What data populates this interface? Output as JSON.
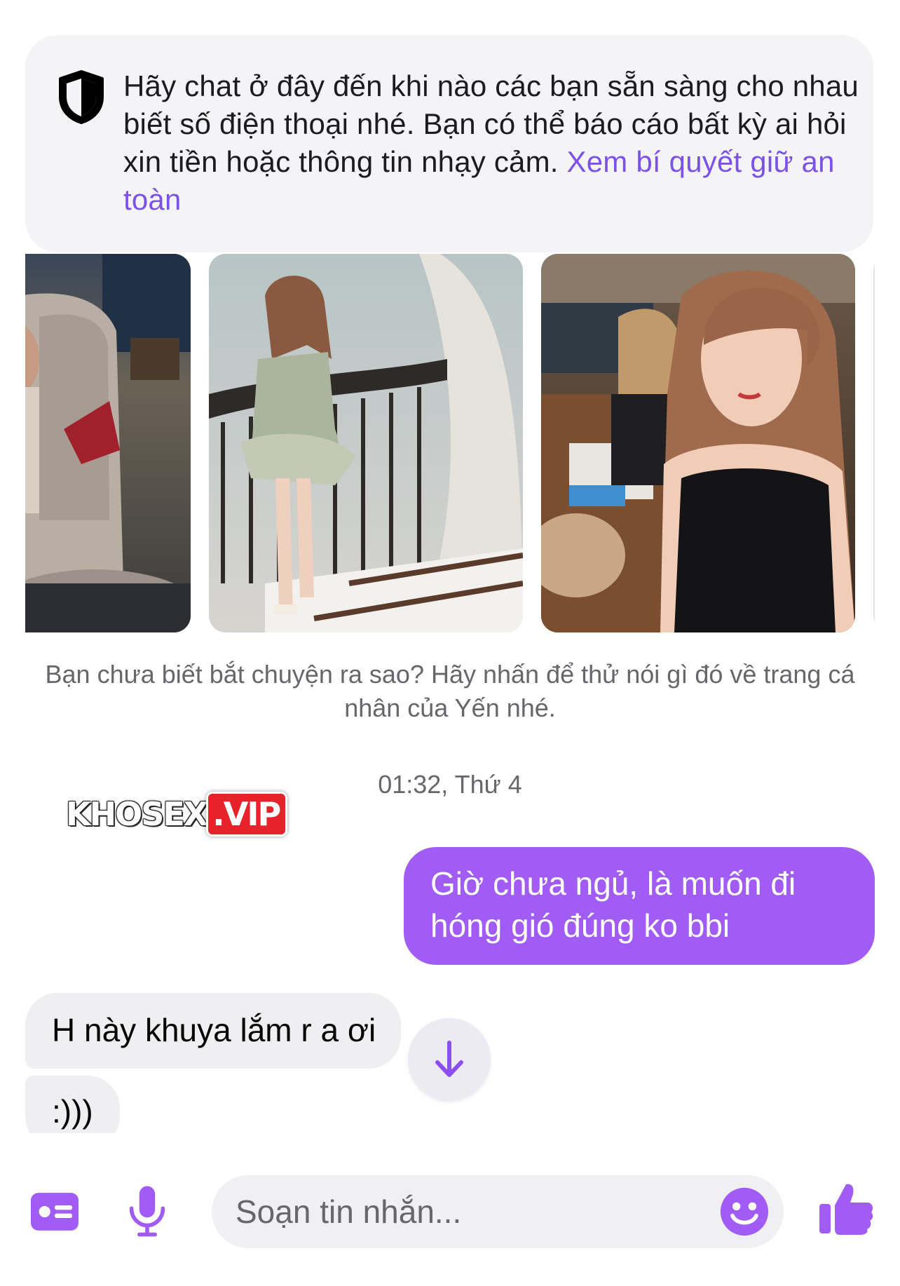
{
  "safety_notice": {
    "icon": "shield-icon",
    "text": "Hãy chat ở đây đến khi nào các bạn sẵn sàng cho nhau biết số điện thoại nhé. Bạn có thể báo cáo bất kỳ ai hỏi xin tiền hoặc thông tin nhạy cảm.",
    "link": "Xem bí quyết giữ an toàn"
  },
  "profile_hint": "Bạn chưa biết bắt chuyện ra sao? Hãy nhấn để thử nói gì đó về trang cá nhân của Yến nhé.",
  "timestamp": "01:32, Thứ 4",
  "watermark": {
    "part1": "KHOSEX",
    "part2": ".VIP"
  },
  "messages": [
    {
      "direction": "outgoing",
      "text": "Giờ chưa ngủ, là muốn đi hóng gió đúng ko bbi"
    },
    {
      "direction": "incoming",
      "text": "H này khuya lắm r a ơi"
    },
    {
      "direction": "incoming",
      "text": ":)))"
    }
  ],
  "composer": {
    "placeholder": "Soạn tin nhắn...",
    "icons": [
      "id-card-icon",
      "microphone-icon",
      "emoji-icon",
      "thumbs-up-icon"
    ]
  },
  "colors": {
    "accent": "#a05cf5",
    "link": "#7b52e6",
    "incoming_bubble": "#efeff1"
  }
}
